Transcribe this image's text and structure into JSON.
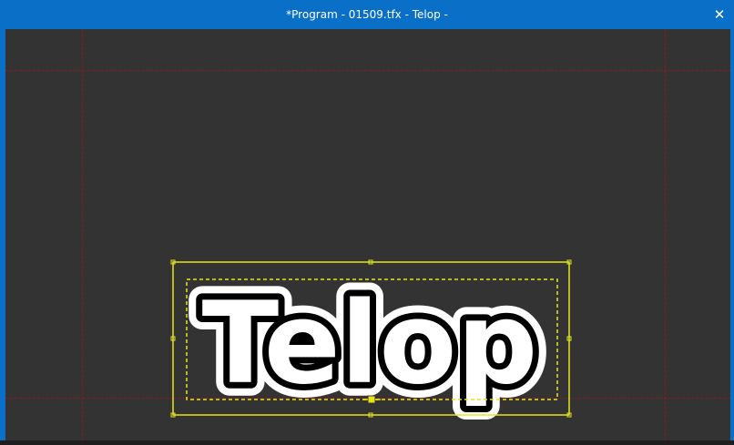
{
  "window": {
    "title": "*Program - 01509.tfx - Telop -",
    "close_label": "✕"
  },
  "canvas": {
    "background_color": "#333333",
    "guide_color": "#8b1a1a",
    "telop": {
      "text": "Telop",
      "fill_color": "#ffffff",
      "inner_outline_color": "#000000",
      "outer_outline_color": "#ffffff",
      "selection_color": "#e6e61a"
    }
  },
  "colors": {
    "titlebar": "#0a6fc6",
    "title_text": "#ffffff"
  }
}
